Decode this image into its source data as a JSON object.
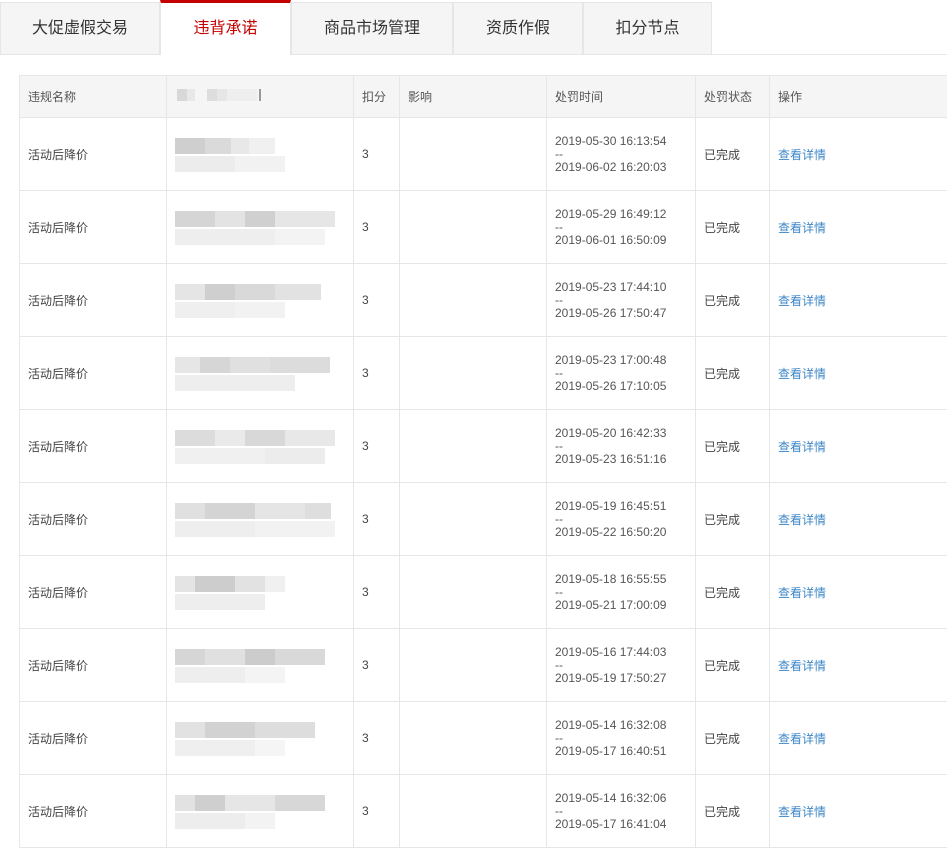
{
  "tabs": [
    {
      "label": "大促虚假交易",
      "active": false
    },
    {
      "label": "违背承诺",
      "active": true
    },
    {
      "label": "商品市场管理",
      "active": false
    },
    {
      "label": "资质作假",
      "active": false
    },
    {
      "label": "扣分节点",
      "active": false
    }
  ],
  "table": {
    "headers": {
      "name": "违规名称",
      "product": "",
      "points": "扣分",
      "impact": "影响",
      "time": "处罚时间",
      "status": "处罚状态",
      "action": "操作"
    },
    "rows": [
      {
        "name": "活动后降价",
        "points": "3",
        "impact": "",
        "start": "2019-05-30 16:13:54",
        "sep": "--",
        "end": "2019-06-02 16:20:03",
        "status": "已完成",
        "action": "查看详情"
      },
      {
        "name": "活动后降价",
        "points": "3",
        "impact": "",
        "start": "2019-05-29 16:49:12",
        "sep": "--",
        "end": "2019-06-01 16:50:09",
        "status": "已完成",
        "action": "查看详情"
      },
      {
        "name": "活动后降价",
        "points": "3",
        "impact": "",
        "start": "2019-05-23 17:44:10",
        "sep": "--",
        "end": "2019-05-26 17:50:47",
        "status": "已完成",
        "action": "查看详情"
      },
      {
        "name": "活动后降价",
        "points": "3",
        "impact": "",
        "start": "2019-05-23 17:00:48",
        "sep": "--",
        "end": "2019-05-26 17:10:05",
        "status": "已完成",
        "action": "查看详情"
      },
      {
        "name": "活动后降价",
        "points": "3",
        "impact": "",
        "start": "2019-05-20 16:42:33",
        "sep": "--",
        "end": "2019-05-23 16:51:16",
        "status": "已完成",
        "action": "查看详情"
      },
      {
        "name": "活动后降价",
        "points": "3",
        "impact": "",
        "start": "2019-05-19 16:45:51",
        "sep": "--",
        "end": "2019-05-22 16:50:20",
        "status": "已完成",
        "action": "查看详情"
      },
      {
        "name": "活动后降价",
        "points": "3",
        "impact": "",
        "start": "2019-05-18 16:55:55",
        "sep": "--",
        "end": "2019-05-21 17:00:09",
        "status": "已完成",
        "action": "查看详情"
      },
      {
        "name": "活动后降价",
        "points": "3",
        "impact": "",
        "start": "2019-05-16 17:44:03",
        "sep": "--",
        "end": "2019-05-19 17:50:27",
        "status": "已完成",
        "action": "查看详情"
      },
      {
        "name": "活动后降价",
        "points": "3",
        "impact": "",
        "start": "2019-05-14 16:32:08",
        "sep": "--",
        "end": "2019-05-17 16:40:51",
        "status": "已完成",
        "action": "查看详情"
      },
      {
        "name": "活动后降价",
        "points": "3",
        "impact": "",
        "start": "2019-05-14 16:32:06",
        "sep": "--",
        "end": "2019-05-17 16:41:04",
        "status": "已完成",
        "action": "查看详情"
      }
    ]
  },
  "colors": {
    "accent": "#c40000",
    "link": "#3d87c7",
    "tab_bg": "#f5f5f5",
    "border": "#e6e6e6"
  }
}
